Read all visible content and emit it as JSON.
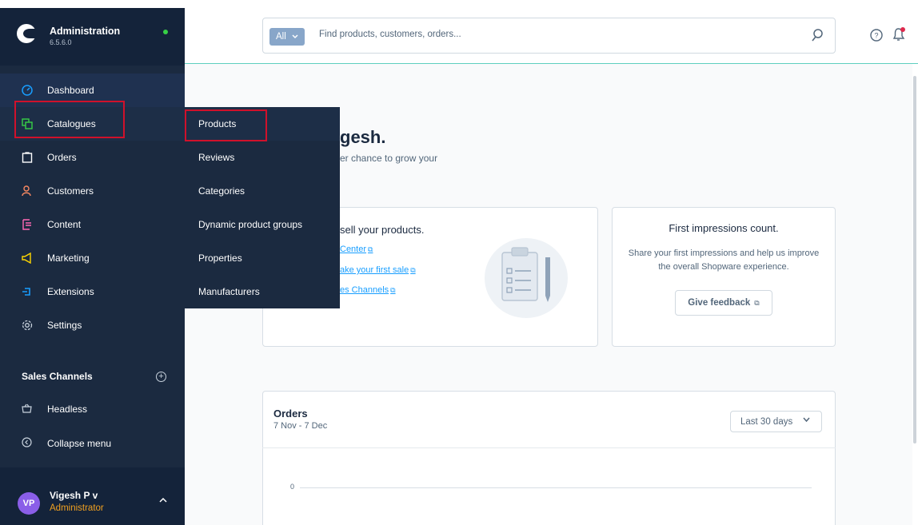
{
  "app": {
    "title": "Administration",
    "version": "6.5.6.0"
  },
  "search": {
    "type_label": "All",
    "placeholder": "Find products, customers, orders..."
  },
  "nav": {
    "items": [
      {
        "label": "Dashboard",
        "icon": "dashboard-icon"
      },
      {
        "label": "Catalogues",
        "icon": "catalogues-icon"
      },
      {
        "label": "Orders",
        "icon": "orders-icon"
      },
      {
        "label": "Customers",
        "icon": "customers-icon"
      },
      {
        "label": "Content",
        "icon": "content-icon"
      },
      {
        "label": "Marketing",
        "icon": "marketing-icon"
      },
      {
        "label": "Extensions",
        "icon": "extensions-icon"
      },
      {
        "label": "Settings",
        "icon": "settings-icon"
      }
    ],
    "sales_channels_title": "Sales Channels",
    "headless": "Headless",
    "collapse": "Collapse menu"
  },
  "flyout": {
    "items": [
      "Products",
      "Reviews",
      "Categories",
      "Dynamic product groups",
      "Properties",
      "Manufacturers"
    ]
  },
  "user": {
    "initials": "VP",
    "name": "Vigesh P v",
    "role": "Administrator"
  },
  "dashboard": {
    "greeting": "gesh.",
    "greeting_sub": "er chance to grow your",
    "card1": {
      "title": "sell your products.",
      "links": [
        "Center",
        "ake your first sale",
        "es Channels"
      ]
    },
    "card2": {
      "title": "First impressions count.",
      "text": "Share your first impressions and help us improve the overall Shopware experience.",
      "button": "Give feedback"
    },
    "orders": {
      "title": "Orders",
      "range": "7 Nov - 7 Dec",
      "period": "Last 30 days",
      "axis_zero": "0"
    }
  },
  "colors": {
    "sidebar": "#1b2a40",
    "highlight": "#d0112b",
    "link": "#189eff",
    "role": "#f0a020",
    "status": "#37d046"
  }
}
